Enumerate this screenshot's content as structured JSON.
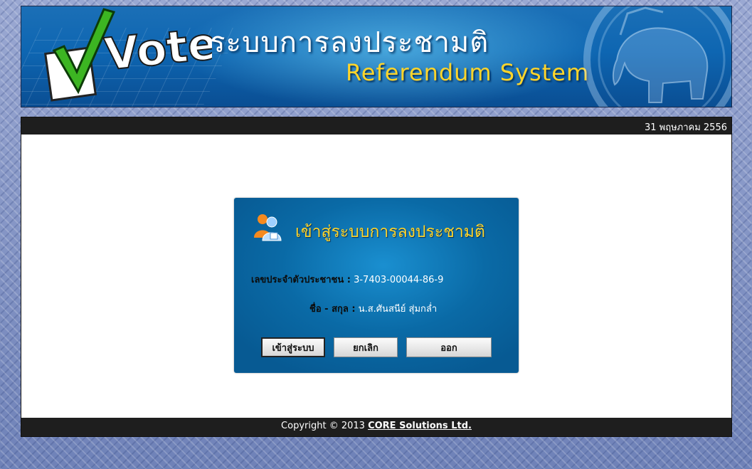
{
  "banner": {
    "logo_text": "Vote",
    "title_th": "ระบบการลงประชามติ",
    "title_en": "Referendum System"
  },
  "header": {
    "date": "31 พฤษภาคม 2556"
  },
  "login": {
    "title": "เข้าสู่ระบบการลงประชามติ",
    "id_label": "เลขประจำตัวประชาชน :",
    "id_value": "3-7403-00044-86-9",
    "name_label": "ชื่อ - สกุล :",
    "name_value": "น.ส.ศันสนีย์ สุ่มกล่ำ",
    "buttons": {
      "login": "เข้าสู่ระบบ",
      "cancel": "ยกเลิก",
      "exit": "ออก"
    }
  },
  "footer": {
    "copyright": "Copyright © 2013",
    "company": "CORE Solutions Ltd."
  },
  "colors": {
    "accent_yellow": "#ffd52a",
    "banner_blue": "#0e66b2",
    "bar_dark": "#1e1e1e",
    "panel_blue": "#0a6aa6"
  }
}
